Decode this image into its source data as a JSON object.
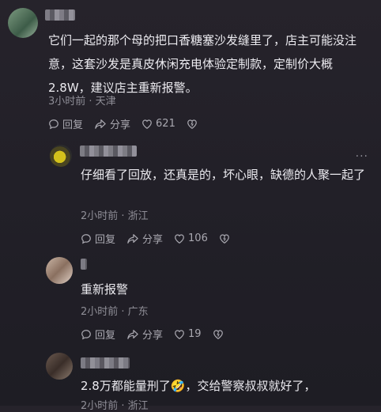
{
  "comments": [
    {
      "text": "它们一起的那个母的把口香糖塞沙发缝里了，店主可能没注意，这套沙发是真皮休闲充电体验定制款，定制价大概2.8W，建议店主重新报警。",
      "meta": "3小时前 · 天津",
      "reply": "回复",
      "share": "分享",
      "likes": "621"
    },
    {
      "text": "仔细看了回放，还真是的，坏心眼，缺德的人聚一起了",
      "meta": "2小时前 · 浙江",
      "reply": "回复",
      "share": "分享",
      "likes": "106",
      "more": "···"
    },
    {
      "text": "重新报警",
      "meta": "2小时前 · 广东",
      "reply": "回复",
      "share": "分享",
      "likes": "19"
    },
    {
      "text": "2.8万都能量刑了🤣，交给警察叔叔就好了，",
      "meta": "2小时前 · 浙江"
    }
  ]
}
